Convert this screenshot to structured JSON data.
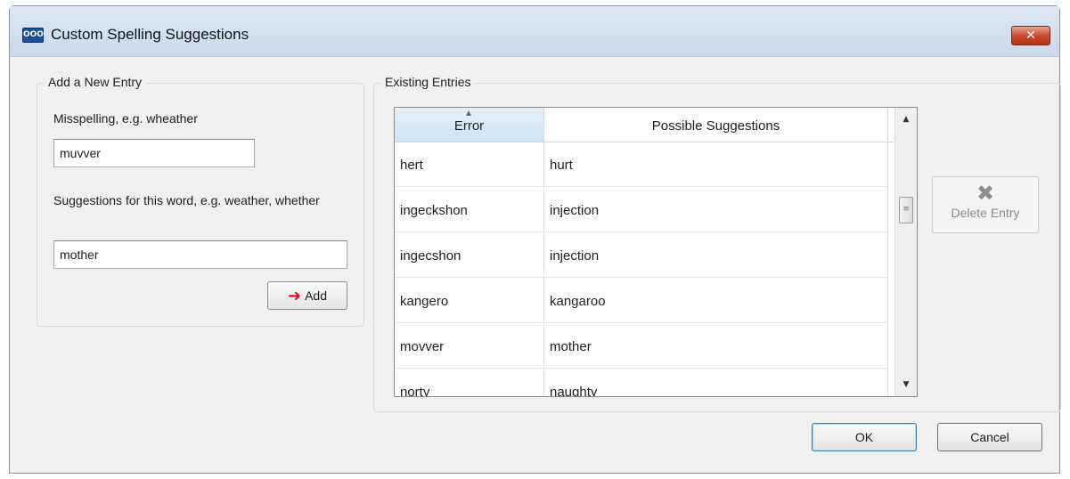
{
  "window": {
    "title": "Custom Spelling Suggestions",
    "app_icon_text": "OOO",
    "close_glyph": "✕"
  },
  "new_entry": {
    "group_title": "Add a New Entry",
    "misspelling_label": "Misspelling, e.g. wheather",
    "misspelling_value": "muvver",
    "suggestions_label": "Suggestions for this word, e.g. weather, whether",
    "suggestions_value": "mother",
    "add_label": "Add"
  },
  "existing": {
    "group_title": "Existing Entries",
    "columns": [
      "Error",
      "Possible Suggestions"
    ],
    "rows": [
      {
        "error": "hert",
        "suggestion": "hurt"
      },
      {
        "error": "ingeckshon",
        "suggestion": "injection"
      },
      {
        "error": "ingecshon",
        "suggestion": "injection"
      },
      {
        "error": "kangero",
        "suggestion": "kangaroo"
      },
      {
        "error": "movver",
        "suggestion": "mother"
      },
      {
        "error": "norty",
        "suggestion": "naughty"
      }
    ],
    "delete_label": "Delete Entry"
  },
  "buttons": {
    "ok": "OK",
    "cancel": "Cancel"
  },
  "colors": {
    "accent": "#3c7fb1",
    "close_red": "#c9452a",
    "add_arrow": "#d8141b"
  }
}
